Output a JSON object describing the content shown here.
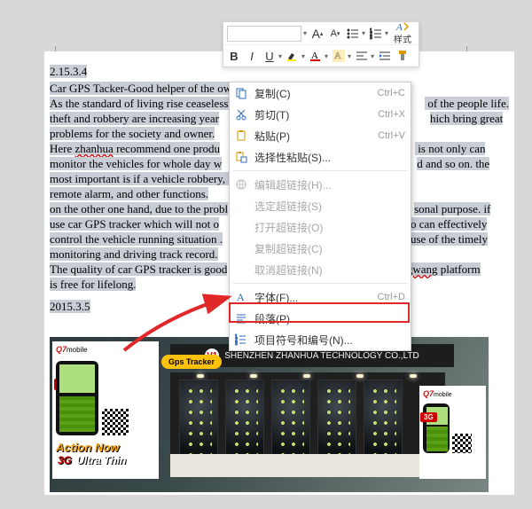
{
  "doc": {
    "date1": "2.15.3.4",
    "title": "Car GPS Tacker-Good helper of the owner.",
    "p1a": "As the standard of living rise ceaselessl",
    "p1b": " of the people life.",
    "p2a": "theft and robbery are increasing year",
    "p2b": "hich bring great",
    "p3": "problems for the society and owner.",
    "p4a": "Here ",
    "p4_red": "zhanhua",
    "p4b": " recommend one produ",
    "p4c": " is not only can",
    "p5a": "monitor the vehicles for whole day w",
    "p5b": "d and so on. the",
    "p6": "most important is if a vehicle robbery, t",
    "p7": "remote alarm, and other functions.",
    "p8a": "on the other one hand, due to the probl",
    "p8b": "sonal purpose. if",
    "p9a": "use car GPS tracker which will not o",
    "p9b": "o can effectively",
    "p10a": "control the vehicle running situation .",
    "p10b": "use of the timely",
    "p11": "monitoring and driving track record.",
    "p12a": "The quality of car GPS tracker is good",
    "p12b_red": "ngwang",
    "p12c": " platform",
    "p13": "is free for lifelong.",
    "date2": "2015.3.5"
  },
  "toolbar": {
    "font_inc": "A",
    "font_dec": "A",
    "style_label": "样式",
    "B": "B",
    "I": "I",
    "U": "U"
  },
  "menu": {
    "copy": "复制(C)",
    "copy_k": "Ctrl+C",
    "cut": "剪切(T)",
    "cut_k": "Ctrl+X",
    "paste": "粘贴(P)",
    "paste_k": "Ctrl+V",
    "paste_special": "选择性粘贴(S)...",
    "edit_link": "编辑超链接(H)...",
    "select_link": "选定超链接(S)",
    "open_link": "打开超链接(O)",
    "copy_link": "复制超链接(C)",
    "remove_link": "取消超链接(N)",
    "font": "字体(F)...",
    "font_k": "Ctrl+D",
    "paragraph": "段落(P)...",
    "bullets": "项目符号和编号(N)..."
  },
  "photo": {
    "brand": "Q7",
    "brand_suffix": "mobile",
    "badge": "3G",
    "gps_tag": "Gps Tracker",
    "banner_logo": "V1",
    "banner_text": "SHENZHEN ZHANHUA TECHNOLOGY CO.,LTD",
    "action": "Action Now",
    "ultra_prefix": "3G",
    "ultra": " Ultra Thin"
  }
}
